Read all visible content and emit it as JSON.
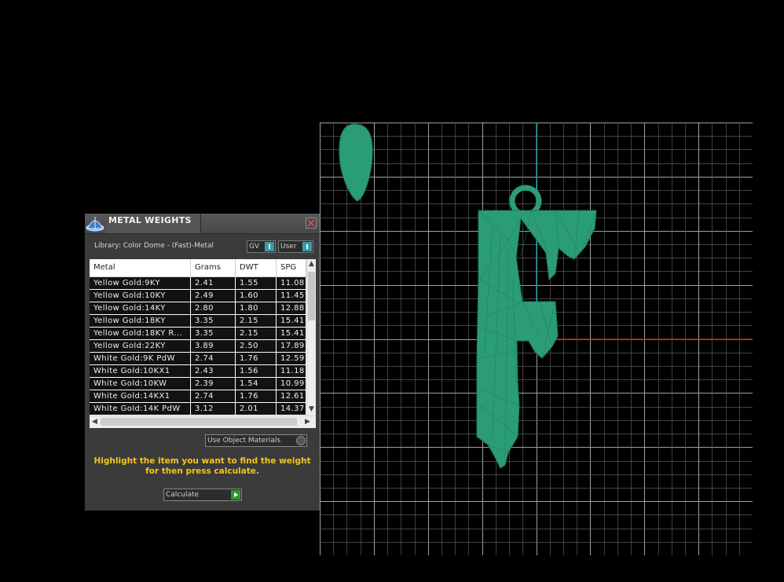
{
  "panel": {
    "title": "METAL WEIGHTS",
    "library_label": "Library: Color Dome - (Fast)-Metal",
    "gv_label": "GV",
    "user_label": "User",
    "use_object_materials_label": "Use Object Materials",
    "instructions": "Highlight the item you want to find the weight for then press calculate.",
    "calculate_label": "Calculate"
  },
  "table": {
    "headers": [
      "Metal",
      "Grams",
      "DWT",
      "SPG"
    ],
    "rows": [
      [
        "Yellow Gold:9KY",
        "2.41",
        "1.55",
        "11.08"
      ],
      [
        "Yellow Gold:10KY",
        "2.49",
        "1.60",
        "11.45"
      ],
      [
        "Yellow Gold:14KY",
        "2.80",
        "1.80",
        "12.88"
      ],
      [
        "Yellow Gold:18KY",
        "3.35",
        "2.15",
        "15.41"
      ],
      [
        "Yellow Gold:18KY R...",
        "3.35",
        "2.15",
        "15.41"
      ],
      [
        "Yellow Gold:22KY",
        "3.89",
        "2.50",
        "17.89"
      ],
      [
        "White Gold:9K PdW",
        "2.74",
        "1.76",
        "12.59"
      ],
      [
        "White Gold:10KX1",
        "2.43",
        "1.56",
        "11.18"
      ],
      [
        "White Gold:10KW",
        "2.39",
        "1.54",
        "10.99"
      ],
      [
        "White Gold:14KX1",
        "2.74",
        "1.76",
        "12.61"
      ],
      [
        "White Gold:14K PdW",
        "3.12",
        "2.01",
        "14.37"
      ]
    ]
  },
  "viewport": {
    "model_color": "#2b9c78",
    "grid_color": "#9a9a9a",
    "axis_x_color": "#b22222",
    "axis_y_color": "#1f8fa8"
  },
  "icons": {
    "logo": "dome-logo-icon",
    "close": "close-icon",
    "calculate": "play-arrow-icon"
  }
}
